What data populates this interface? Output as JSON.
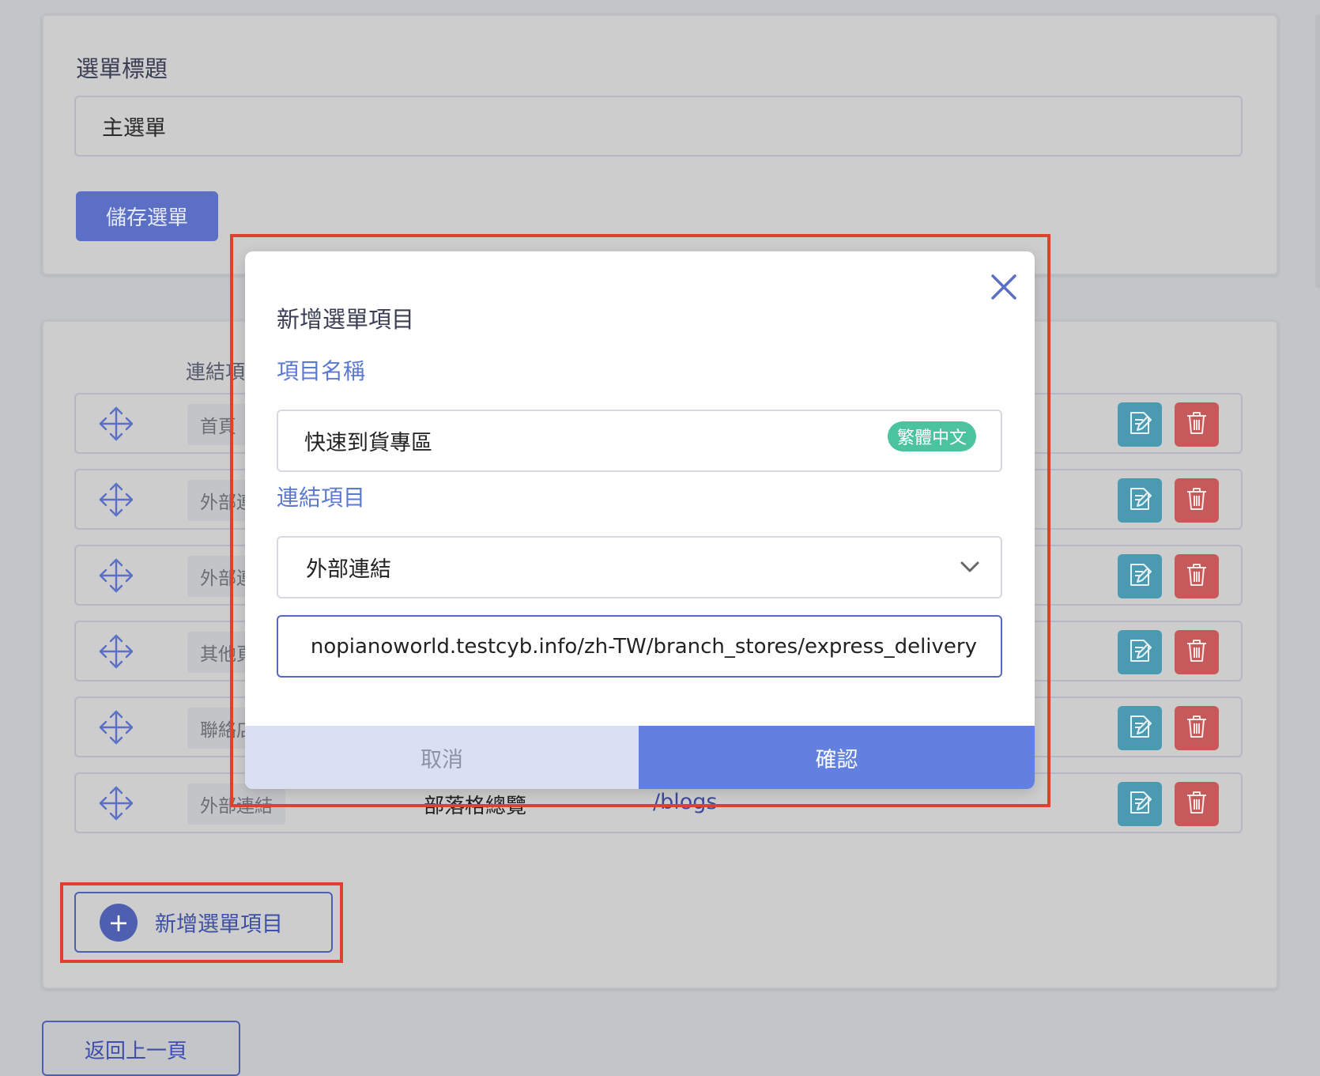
{
  "menu": {
    "title_label": "選單標題",
    "title_value": "主選單",
    "save_label": "儲存選單"
  },
  "items_section": {
    "column_header": "連結項",
    "rows": [
      {
        "tag": "首頁",
        "name": "",
        "url": ""
      },
      {
        "tag": "外部連",
        "name": "",
        "url": ""
      },
      {
        "tag": "外部連",
        "name": "",
        "url": ""
      },
      {
        "tag": "其他頁",
        "name": "",
        "url": ""
      },
      {
        "tag": "聯絡店",
        "name": "",
        "url": ""
      },
      {
        "tag": "外部連結",
        "name": "部落格總覽",
        "url": "/blogs"
      }
    ],
    "add_item_label": "新增選單項目",
    "back_label": "返回上一頁"
  },
  "modal": {
    "title": "新增選單項目",
    "name_label": "項目名稱",
    "name_value": "快速到貨專區",
    "language_badge": "繁體中文",
    "link_label": "連結項目",
    "link_type_value": "外部連結",
    "url_value": "nopianoworld.testcyb.info/zh-TW/branch_stores/express_delivery",
    "cancel_label": "取消",
    "confirm_label": "確認"
  },
  "colors": {
    "primary": "#5b6fc4",
    "edit": "#4c9ab2",
    "delete": "#c65a5a",
    "badge": "#4cc39f",
    "confirm": "#6180e0",
    "highlight": "#e0402f"
  }
}
